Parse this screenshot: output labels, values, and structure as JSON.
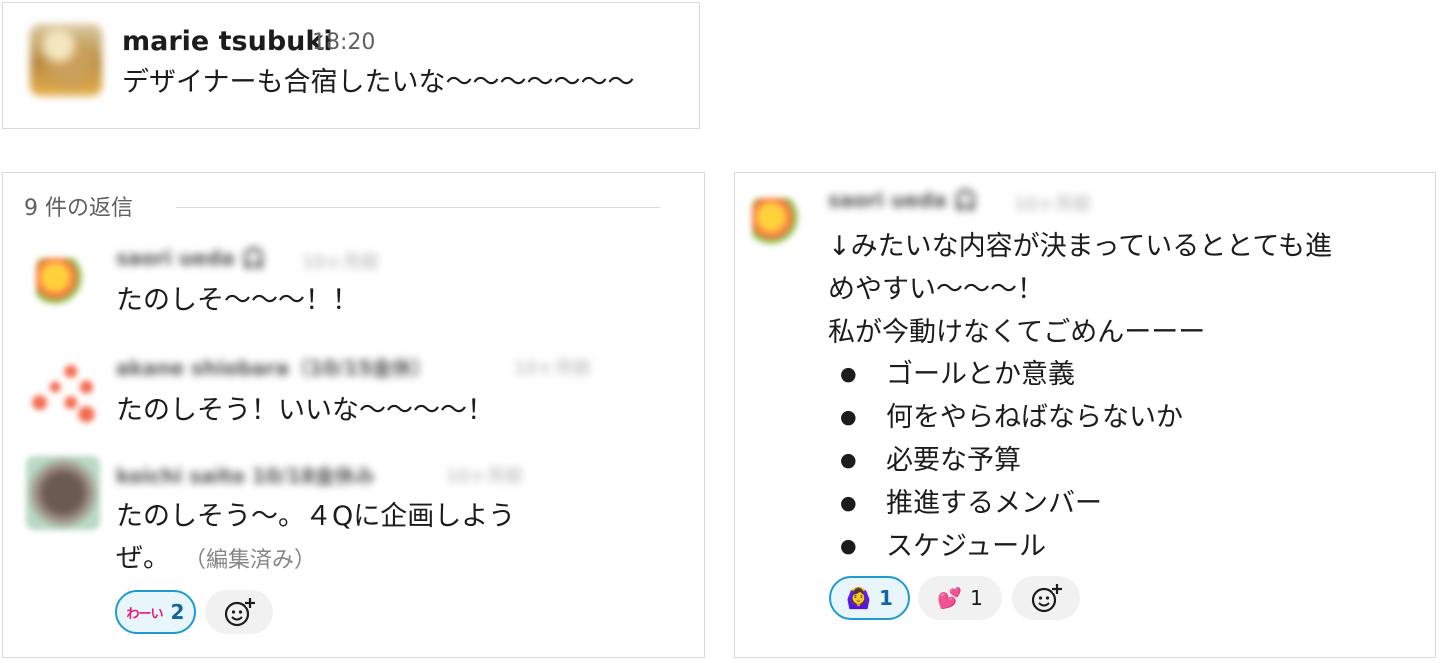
{
  "top_message": {
    "author": "marie tsubuki",
    "time": "18:20",
    "text": "デザイナーも合宿したいな〜〜〜〜〜〜〜"
  },
  "thread": {
    "reply_count_label": "9 件の返信",
    "replies": [
      {
        "author": "saori ueda 🎧",
        "time": "10ヶ月前",
        "text": "たのしそ〜〜〜！！"
      },
      {
        "author": "akane shiobara（10/15金休）",
        "time": "10ヶ月前",
        "text": "たのしそう！いいな〜〜〜〜！"
      },
      {
        "author": "koichi saito 10/18金休み",
        "time": "10ヶ月前",
        "text_line1": "たのしそう〜。４Qに企画しよう",
        "text_line2": "ぜ。",
        "edited": "（編集済み）",
        "reactions": [
          {
            "emoji": "わーい",
            "count": "2",
            "active": true
          }
        ]
      }
    ]
  },
  "right_message": {
    "author": "saori ueda 🎧",
    "time": "10ヶ月前",
    "line1": "↓みたいな内容が決まっているととても進",
    "line2": "めやすい〜〜〜！",
    "line3": "私が今動けなくてごめんーーー",
    "bullets": [
      "ゴールとか意義",
      "何をやらねばならないか",
      "必要な予算",
      "推進するメンバー",
      "スケジュール"
    ],
    "reactions": [
      {
        "emoji": "🙆‍♀️",
        "count": "1",
        "active": true
      },
      {
        "emoji": "💕",
        "count": "1",
        "active": false
      }
    ]
  },
  "icons": {
    "add_reaction": "add-reaction-icon"
  },
  "colors": {
    "accent": "#1d9bd1",
    "accent_bg": "#e8f5fa",
    "count_active": "#1264a3",
    "wai_pink": "#e8197a"
  }
}
